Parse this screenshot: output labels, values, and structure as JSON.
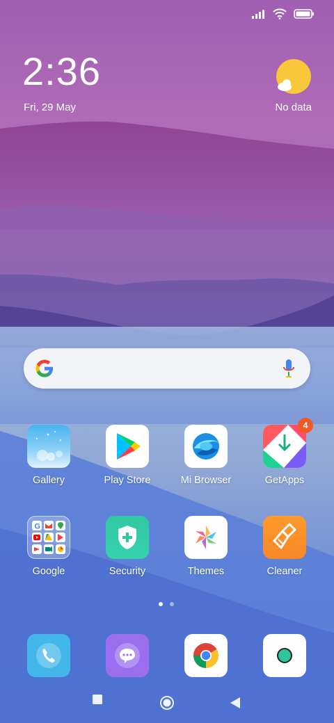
{
  "status": {
    "signal_icon": "signal-icon",
    "wifi_icon": "wifi-icon",
    "battery_icon": "battery-icon"
  },
  "clock": {
    "time": "2:36",
    "date": "Fri, 29 May"
  },
  "weather": {
    "icon": "sun-cloud-icon",
    "text": "No data"
  },
  "search": {
    "logo": "google-g-icon",
    "mic": "mic-icon"
  },
  "apps_row1": [
    {
      "label": "Gallery",
      "icon": "gallery-icon"
    },
    {
      "label": "Play Store",
      "icon": "play-store-icon"
    },
    {
      "label": "Mi Browser",
      "icon": "mi-browser-icon"
    },
    {
      "label": "GetApps",
      "icon": "getapps-icon",
      "badge": "4"
    }
  ],
  "apps_row2": [
    {
      "label": "Google",
      "icon": "google-folder-icon"
    },
    {
      "label": "Security",
      "icon": "security-icon"
    },
    {
      "label": "Themes",
      "icon": "themes-icon"
    },
    {
      "label": "Cleaner",
      "icon": "cleaner-icon"
    }
  ],
  "page_indicator": {
    "pages": 2,
    "current": 1
  },
  "dock": [
    {
      "icon": "phone-icon"
    },
    {
      "icon": "messaging-icon"
    },
    {
      "icon": "chrome-icon"
    },
    {
      "icon": "camera-icon"
    }
  ],
  "nav": {
    "recents": "recents-icon",
    "home": "home-icon",
    "back": "back-icon"
  },
  "colors": {
    "accent_badge": "#f25a22",
    "search_bg": "#f3f4f7"
  }
}
